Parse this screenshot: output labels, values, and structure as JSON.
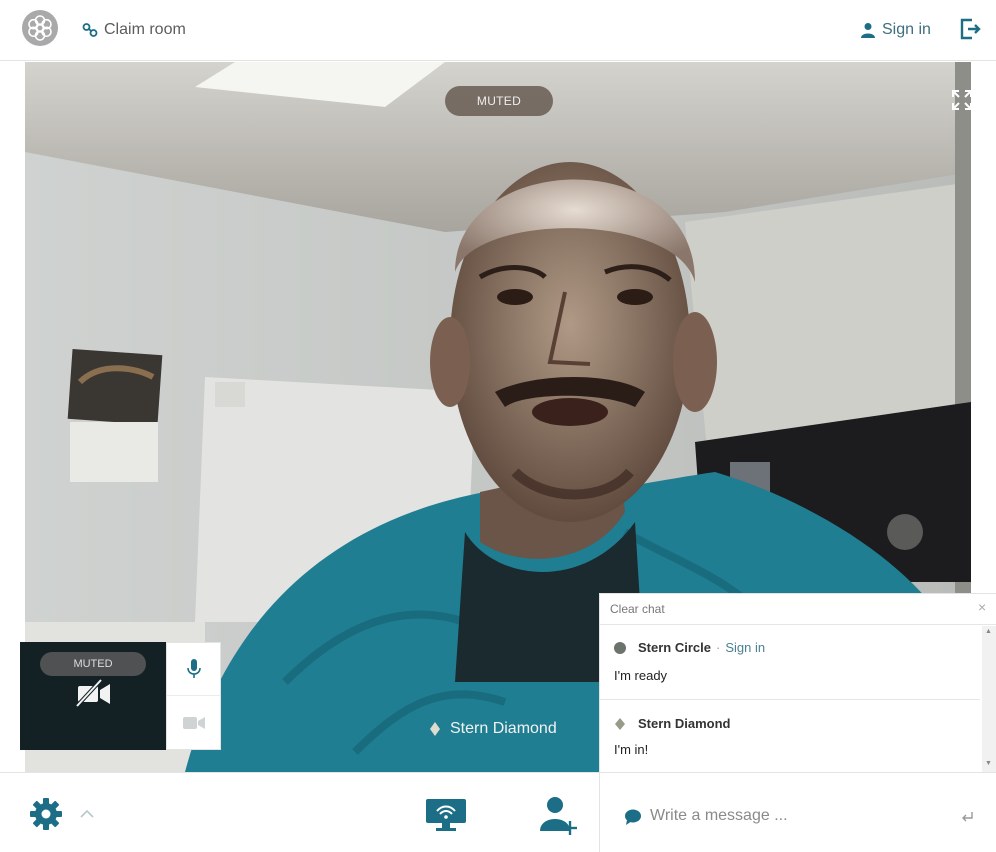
{
  "header": {
    "logo": "flower-logo-icon",
    "claim_room": "Claim room",
    "sign_in": "Sign in",
    "leave_icon": "exit-icon"
  },
  "video": {
    "remote_status": "MUTED",
    "remote_name": "Stern Diamond",
    "local_status": "MUTED",
    "fullscreen_icon": "fullscreen-icon"
  },
  "chat": {
    "clear_label": "Clear chat",
    "close_glyph": "×",
    "messages": [
      {
        "user": "Stern Circle",
        "separator": "·",
        "action": "Sign in",
        "text": "I'm ready",
        "avatar": "circle"
      },
      {
        "user": "Stern Diamond",
        "text": "I'm in!",
        "avatar": "diamond"
      }
    ],
    "input_placeholder": "Write a message ..."
  },
  "toolbar": {
    "settings_icon": "gear-icon",
    "screen_share_icon": "screen-share-icon",
    "invite_icon": "add-user-icon"
  },
  "colors": {
    "accent": "#1c6e86",
    "muted_link": "#4a8191",
    "chat_circle": "#6c726c",
    "chat_diamond": "#9a9a88"
  }
}
